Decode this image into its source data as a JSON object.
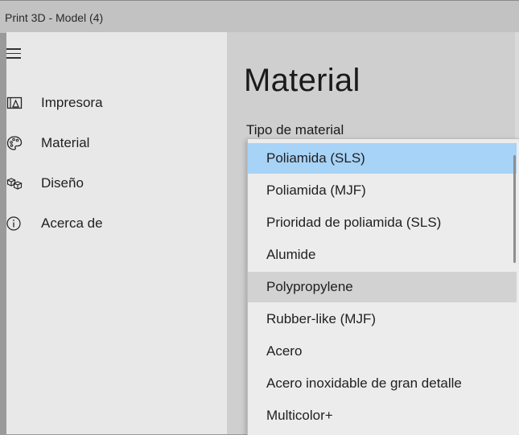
{
  "window": {
    "title": "Print 3D - Model (4)"
  },
  "sidebar": {
    "items": [
      {
        "label": "Impresora",
        "icon": "printer-3d-icon"
      },
      {
        "label": "Material",
        "icon": "palette-icon"
      },
      {
        "label": "Diseño",
        "icon": "cubes-icon"
      },
      {
        "label": "Acerca de",
        "icon": "info-icon"
      }
    ]
  },
  "main": {
    "title": "Material",
    "material_type_label": "Tipo de material"
  },
  "dropdown": {
    "selected": "Poliamida (SLS)",
    "hovered": "Polypropylene",
    "options": [
      "Poliamida (SLS)",
      "Poliamida (MJF)",
      "Prioridad de poliamida (SLS)",
      "Alumide",
      "Polypropylene",
      "Rubber-like (MJF)",
      "Acero",
      "Acero inoxidable de gran detalle",
      "Multicolor+"
    ]
  },
  "colors": {
    "selected_bg": "#a7d3f7",
    "hover_bg": "#d2d2d2",
    "sidebar_bg": "#e8e8e8",
    "content_bg": "#cfcfcf"
  }
}
